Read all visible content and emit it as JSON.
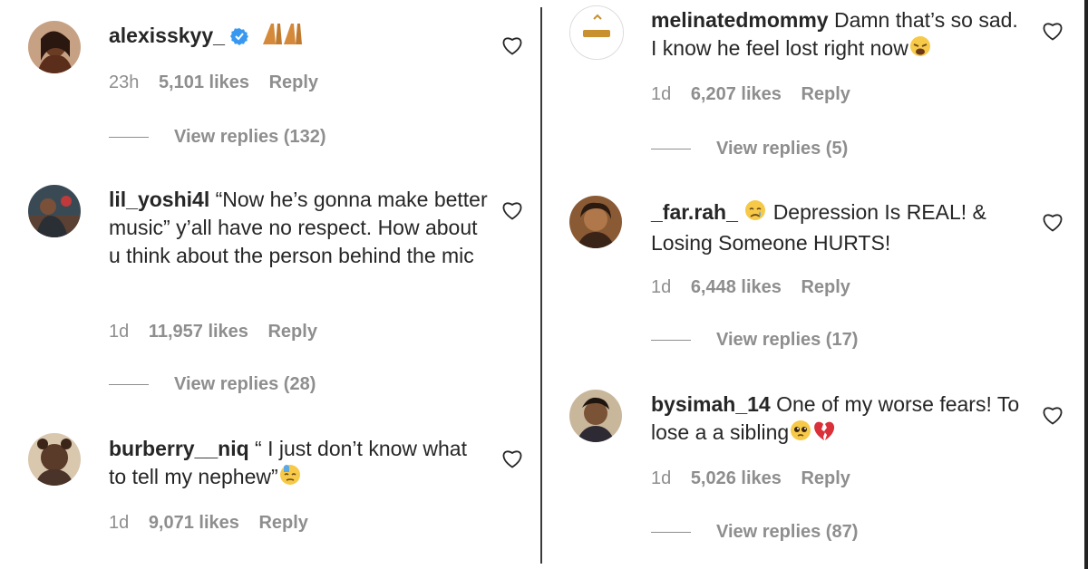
{
  "comments": [
    {
      "username": "alexisskyy_",
      "verified": true,
      "text": "",
      "emoji": "folded-hands",
      "time": "23h",
      "likes": "5,101 likes",
      "reply": "Reply",
      "view_replies": "View replies (132)"
    },
    {
      "username": "lil_yoshi4l",
      "text": "“Now he’s gonna make better music” y’all have no respect. How about u think about the person behind the mic",
      "time": "1d",
      "likes": "11,957 likes",
      "reply": "Reply",
      "view_replies": "View replies (28)"
    },
    {
      "username": "burberry__niq",
      "text": "“ I just don’t know what to tell my nephew”",
      "emoji": "downcast-sweat",
      "time": "1d",
      "likes": "9,071 likes",
      "reply": "Reply"
    },
    {
      "username": "melinatedmommy",
      "text": "Damn that’s so sad. I know he feel lost right now",
      "emoji": "weary-face",
      "time": "1d",
      "likes": "6,207 likes",
      "reply": "Reply",
      "view_replies": "View replies (5)"
    },
    {
      "username": "_far.rah_",
      "text": "Depression Is REAL! & Losing Someone HURTS!",
      "emoji": "crying-face",
      "time": "1d",
      "likes": "6,448 likes",
      "reply": "Reply",
      "view_replies": "View replies (17)"
    },
    {
      "username": "bysimah_14",
      "text": "One of my worse fears! To lose a a sibling",
      "emoji": "pleading-face, broken-heart",
      "time": "1d",
      "likes": "5,026 likes",
      "reply": "Reply",
      "view_replies": "View replies (87)"
    }
  ],
  "colors": {
    "text": "#262626",
    "meta": "#8e8e8e",
    "verified": "#3897f0",
    "divider": "#3a3a3a"
  }
}
